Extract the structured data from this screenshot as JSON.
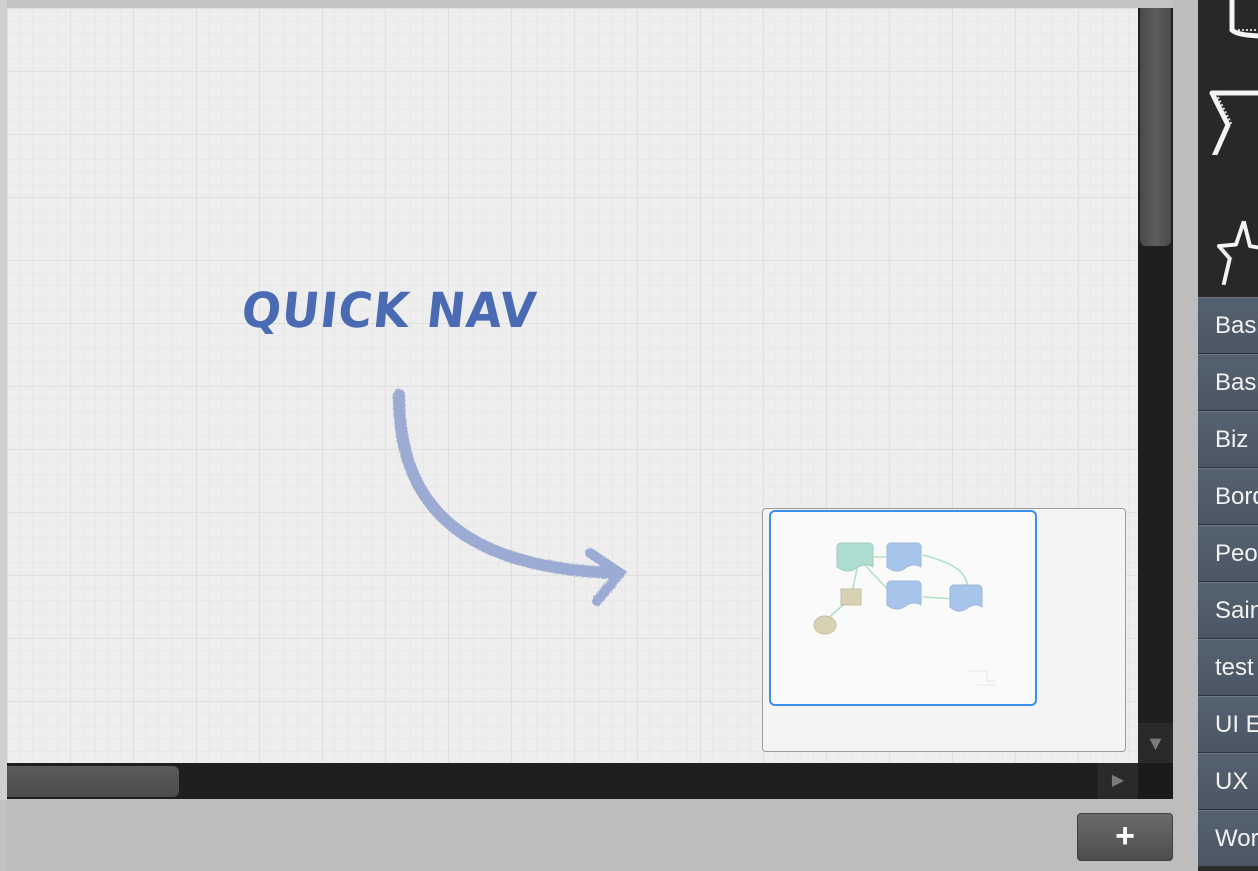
{
  "canvas": {
    "annotation_title": "QUICK NAV"
  },
  "minimap": {
    "node_colors": {
      "start": "#4db39a",
      "process": "#3c7fd0",
      "decision": "#a89a55",
      "end": "#a89a55",
      "link": "#4fbf7f"
    }
  },
  "scrollbars": {
    "down_arrow": "▼",
    "right_arrow": "▶"
  },
  "bottom_bar": {
    "add_label": "+"
  },
  "shape_library": {
    "icons": [
      "rectangle-shape-icon",
      "flag-shape-icon",
      "star-shape-icon"
    ]
  },
  "categories": [
    {
      "label": "Basic"
    },
    {
      "label": "Basic"
    },
    {
      "label": "Biz"
    },
    {
      "label": "Borders"
    },
    {
      "label": "People"
    },
    {
      "label": "Saints"
    },
    {
      "label": "test"
    },
    {
      "label": "UI Elements"
    },
    {
      "label": "UX"
    },
    {
      "label": "Work"
    }
  ]
}
